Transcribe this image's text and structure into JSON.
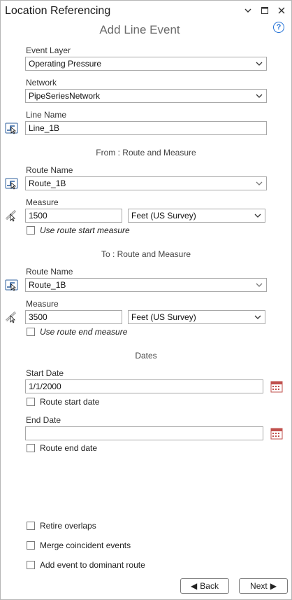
{
  "window": {
    "title": "Location Referencing",
    "subtitle": "Add Line Event"
  },
  "event_layer": {
    "label": "Event Layer",
    "value": "Operating Pressure"
  },
  "network": {
    "label": "Network",
    "value": "PipeSeriesNetwork"
  },
  "line_name": {
    "label": "Line Name",
    "value": "Line_1B"
  },
  "from": {
    "section": "From : Route and Measure",
    "route_label": "Route Name",
    "route_value": "Route_1B",
    "measure_label": "Measure",
    "measure_value": "1500",
    "units": "Feet (US Survey)",
    "use_measure_label": "Use route start measure"
  },
  "to": {
    "section": "To : Route and Measure",
    "route_label": "Route Name",
    "route_value": "Route_1B",
    "measure_label": "Measure",
    "measure_value": "3500",
    "units": "Feet (US Survey)",
    "use_measure_label": "Use route end measure"
  },
  "dates": {
    "section": "Dates",
    "start_label": "Start Date",
    "start_value": "1/1/2000",
    "start_route_label": "Route start date",
    "end_label": "End Date",
    "end_value": "",
    "end_route_label": "Route end date"
  },
  "options": {
    "retire_overlaps": "Retire overlaps",
    "merge_coincident": "Merge coincident events",
    "add_dominant": "Add event to dominant route"
  },
  "buttons": {
    "back": "Back",
    "next": "Next"
  },
  "icons": {
    "help": "help-icon",
    "pin": "pin-icon",
    "maximize": "maximize-icon",
    "close": "close-icon",
    "route_select": "select-route-icon",
    "measure_pick": "pick-measure-icon",
    "calendar": "calendar-icon"
  },
  "colors": {
    "accent": "#1f6fd6",
    "calendar": "#c0504d"
  }
}
